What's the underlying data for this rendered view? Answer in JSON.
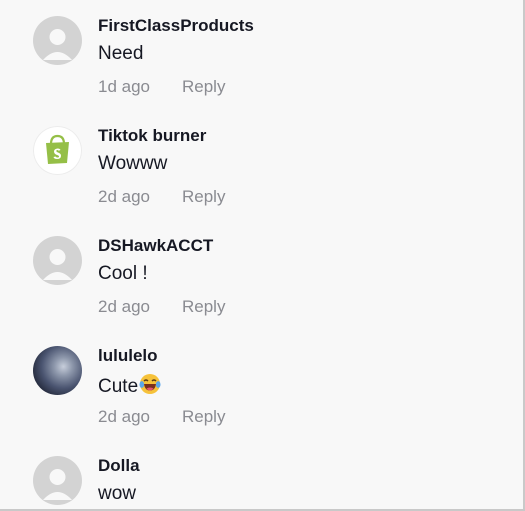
{
  "comments": [
    {
      "username": "FirstClassProducts",
      "text": "Need",
      "time": "1d ago",
      "reply": "Reply",
      "avatar": "default-avatar"
    },
    {
      "username": "Tiktok burner",
      "text": "Wowww",
      "time": "2d ago",
      "reply": "Reply",
      "avatar": "shopify-bag-avatar"
    },
    {
      "username": "DSHawkACCT",
      "text": "Cool !",
      "time": "2d ago",
      "reply": "Reply",
      "avatar": "default-avatar"
    },
    {
      "username": "lululelo",
      "text": "Cute",
      "time": "2d ago",
      "reply": "Reply",
      "avatar": "photo-avatar",
      "emoji": "laughing-crying-emoji"
    },
    {
      "username": "Dolla",
      "text": "wow",
      "avatar": "default-avatar"
    }
  ],
  "colors": {
    "background": "#f8f8f8",
    "username": "#161823",
    "meta": "#8a8b91",
    "default_avatar": "#d3d3d3",
    "shopify_green": "#95bf47"
  }
}
